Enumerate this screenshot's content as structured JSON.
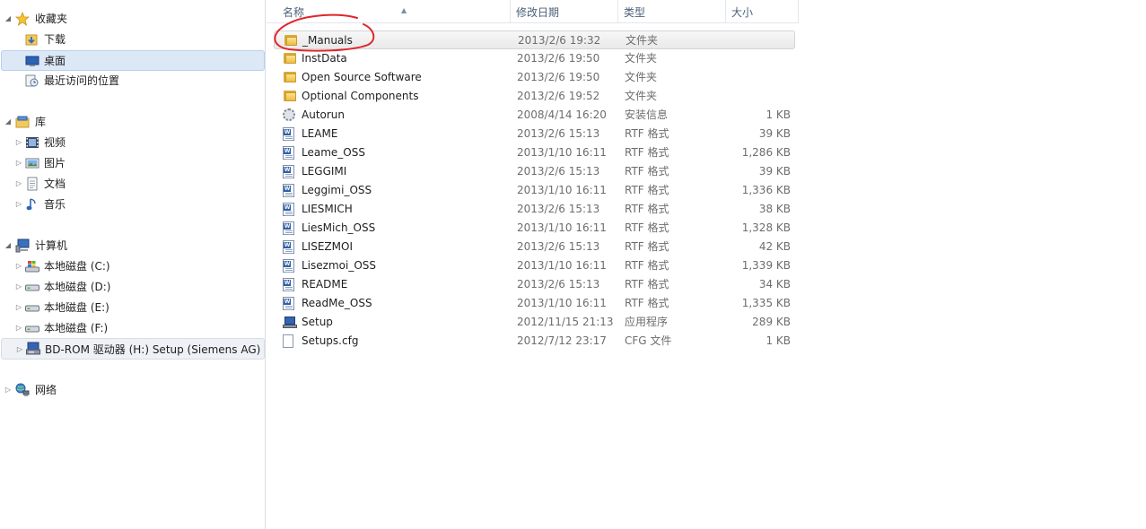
{
  "navigation": {
    "favorites": {
      "label": "收藏夹",
      "items": [
        {
          "label": "下载",
          "icon": "downloads-folder-icon"
        },
        {
          "label": "桌面",
          "icon": "desktop-icon"
        },
        {
          "label": "最近访问的位置",
          "icon": "recent-places-icon"
        }
      ]
    },
    "libraries": {
      "label": "库",
      "items": [
        {
          "label": "视频",
          "icon": "video-library-icon"
        },
        {
          "label": "图片",
          "icon": "picture-library-icon"
        },
        {
          "label": "文档",
          "icon": "document-library-icon"
        },
        {
          "label": "音乐",
          "icon": "music-library-icon"
        }
      ]
    },
    "computer": {
      "label": "计算机",
      "items": [
        {
          "label": "本地磁盘 (C:)",
          "icon": "system-drive-icon"
        },
        {
          "label": "本地磁盘 (D:)",
          "icon": "hard-drive-icon"
        },
        {
          "label": "本地磁盘 (E:)",
          "icon": "hard-drive-icon"
        },
        {
          "label": "本地磁盘 (F:)",
          "icon": "hard-drive-icon"
        },
        {
          "label": "BD-ROM 驱动器 (H:) Setup (Siemens AG)",
          "icon": "setup-drive-icon"
        }
      ]
    },
    "network": {
      "label": "网络",
      "icon": "network-icon"
    }
  },
  "columns": {
    "name": "名称",
    "date": "修改日期",
    "type": "类型",
    "size": "大小"
  },
  "files": [
    {
      "name": "_Manuals",
      "date": "2013/2/6 19:32",
      "type": "文件夹",
      "size": "",
      "icon": "folder"
    },
    {
      "name": "InstData",
      "date": "2013/2/6 19:50",
      "type": "文件夹",
      "size": "",
      "icon": "folder"
    },
    {
      "name": "Open Source Software",
      "date": "2013/2/6 19:50",
      "type": "文件夹",
      "size": "",
      "icon": "folder"
    },
    {
      "name": "Optional Components",
      "date": "2013/2/6 19:52",
      "type": "文件夹",
      "size": "",
      "icon": "folder"
    },
    {
      "name": "Autorun",
      "date": "2008/4/14 16:20",
      "type": "安装信息",
      "size": "1 KB",
      "icon": "settings"
    },
    {
      "name": "LEAME",
      "date": "2013/2/6 15:13",
      "type": "RTF 格式",
      "size": "39 KB",
      "icon": "rtf"
    },
    {
      "name": "Leame_OSS",
      "date": "2013/1/10 16:11",
      "type": "RTF 格式",
      "size": "1,286 KB",
      "icon": "rtf"
    },
    {
      "name": "LEGGIMI",
      "date": "2013/2/6 15:13",
      "type": "RTF 格式",
      "size": "39 KB",
      "icon": "rtf"
    },
    {
      "name": "Leggimi_OSS",
      "date": "2013/1/10 16:11",
      "type": "RTF 格式",
      "size": "1,336 KB",
      "icon": "rtf"
    },
    {
      "name": "LIESMICH",
      "date": "2013/2/6 15:13",
      "type": "RTF 格式",
      "size": "38 KB",
      "icon": "rtf"
    },
    {
      "name": "LiesMich_OSS",
      "date": "2013/1/10 16:11",
      "type": "RTF 格式",
      "size": "1,328 KB",
      "icon": "rtf"
    },
    {
      "name": "LISEZMOI",
      "date": "2013/2/6 15:13",
      "type": "RTF 格式",
      "size": "42 KB",
      "icon": "rtf"
    },
    {
      "name": "Lisezmoi_OSS",
      "date": "2013/1/10 16:11",
      "type": "RTF 格式",
      "size": "1,339 KB",
      "icon": "rtf"
    },
    {
      "name": "README",
      "date": "2013/2/6 15:13",
      "type": "RTF 格式",
      "size": "34 KB",
      "icon": "rtf"
    },
    {
      "name": "ReadMe_OSS",
      "date": "2013/1/10 16:11",
      "type": "RTF 格式",
      "size": "1,335 KB",
      "icon": "rtf"
    },
    {
      "name": "Setup",
      "date": "2012/11/15 21:13",
      "type": "应用程序",
      "size": "289 KB",
      "icon": "application"
    },
    {
      "name": "Setups.cfg",
      "date": "2012/7/12 23:17",
      "type": "CFG 文件",
      "size": "1 KB",
      "icon": "blank"
    }
  ],
  "annotation_color": "#e0262b"
}
